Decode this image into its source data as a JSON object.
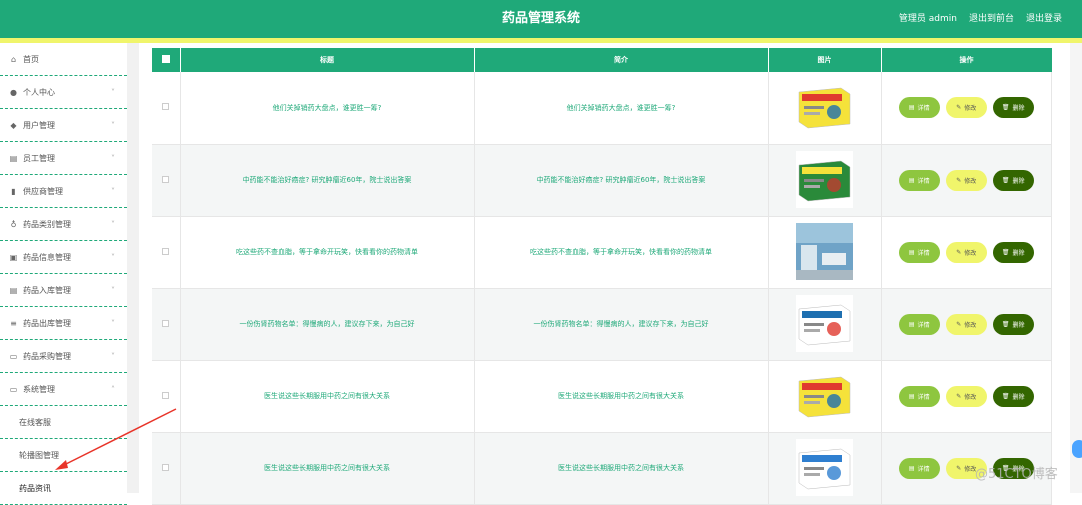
{
  "header": {
    "title": "药品管理系统",
    "admin_label": "管理员 admin",
    "back_label": "退出到前台",
    "logout_label": "退出登录"
  },
  "sidebar": {
    "items": [
      {
        "label": "首页",
        "icon": "home-icon",
        "has_chevron": false
      },
      {
        "label": "个人中心",
        "icon": "user-icon",
        "has_chevron": true
      },
      {
        "label": "用户管理",
        "icon": "location-icon",
        "has_chevron": true
      },
      {
        "label": "员工管理",
        "icon": "clipboard-icon",
        "has_chevron": true
      },
      {
        "label": "供应商管理",
        "icon": "chart-icon",
        "has_chevron": true
      },
      {
        "label": "药品类别管理",
        "icon": "mic-icon",
        "has_chevron": true
      },
      {
        "label": "药品信息管理",
        "icon": "briefcase-icon",
        "has_chevron": true
      },
      {
        "label": "药品入库管理",
        "icon": "clipboard-icon",
        "has_chevron": true
      },
      {
        "label": "药品出库管理",
        "icon": "list-icon",
        "has_chevron": true
      },
      {
        "label": "药品采购管理",
        "icon": "monitor-icon",
        "has_chevron": true
      },
      {
        "label": "系统管理",
        "icon": "monitor-icon",
        "has_chevron": true,
        "expanded": true
      }
    ],
    "sub_items": [
      {
        "label": "在线客服"
      },
      {
        "label": "轮播图管理"
      },
      {
        "label": "药品资讯",
        "active": true
      }
    ]
  },
  "table": {
    "headers": [
      "标题",
      "简介",
      "图片",
      "操作"
    ],
    "rows": [
      {
        "title": "他们关掉销药大盘点，谁更胜一筹?",
        "intro": "他们关掉销药大盘点，谁更胜一筹?",
        "image": "medicine-box-yellow"
      },
      {
        "title": "中药能不能治好癌症? 研究肿瘤近60年，院士说出答案",
        "intro": "中药能不能治好癌症? 研究肿瘤近60年，院士说出答案",
        "image": "medicine-box-green"
      },
      {
        "title": "吃这些药不查血脂，等于拿命开玩笑，快看看你的药物清单",
        "intro": "吃这些药不查血脂，等于拿命开玩笑，快看看你的药物清单",
        "image": "hospital-room"
      },
      {
        "title": "一份伤肾药物名单：得慢病的人，建议存下来，为自己好",
        "intro": "一份伤肾药物名单：得慢病的人，建议存下来，为自己好",
        "image": "medicine-box-white"
      },
      {
        "title": "医生说这些长期服用中药之间有很大关系",
        "intro": "医生说这些长期服用中药之间有很大关系",
        "image": "medicine-box-yellow"
      },
      {
        "title": "医生说这些长期服用中药之间有很大关系",
        "intro": "医生说这些长期服用中药之间有很大关系",
        "image": "medicine-box-blue"
      }
    ],
    "actions": {
      "detail": "详情",
      "edit": "修改",
      "delete": "删除"
    }
  },
  "watermark": "@51CTO博客",
  "colors": {
    "primary": "#1fa979",
    "accent_yellow": "#f0f56b",
    "detail_green": "#8ec63f",
    "delete_dark": "#336600"
  }
}
